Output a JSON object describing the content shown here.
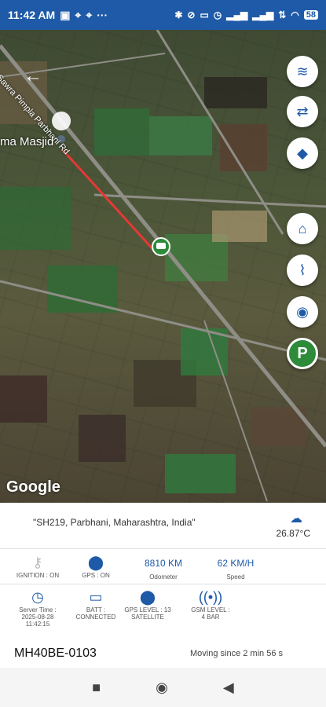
{
  "status_bar": {
    "time": "11:42 AM",
    "left_icons": [
      "message-icon",
      "location-icon",
      "location-icon",
      "more-icon"
    ],
    "right_icons": [
      "bluetooth-icon",
      "mute-icon",
      "battery-saver-icon",
      "alarm-icon",
      "signal-icon",
      "signal-icon",
      "data-icon",
      "wifi-icon"
    ],
    "battery": "58"
  },
  "map": {
    "road_label": "Sawra Pimpla Parbhani Rd",
    "place_label": "ma Masjid",
    "attribution": "Google",
    "route_color": "#e53935",
    "vehicle_marker_color": "#2e8b3a",
    "fabs": [
      "layers-icon",
      "swap-icon",
      "directions-icon",
      "geofence-icon",
      "attachment-icon",
      "my-location-icon",
      "parking-icon"
    ]
  },
  "info": {
    "address": "\"SH219, Parbhani, Maharashtra, India\"",
    "temperature": "26.87°C",
    "weather_icon": "partly-cloudy-icon",
    "stats_row1": [
      {
        "icon": "key-icon",
        "value": "",
        "label": "IGNITION : ON"
      },
      {
        "icon": "location-pin-icon",
        "value": "",
        "label": "GPS : ON"
      },
      {
        "icon": "",
        "value": "8810 KM",
        "label": "Odometer"
      },
      {
        "icon": "",
        "value": "62 KM/H",
        "label": "Speed"
      }
    ],
    "server_time_label": "Server Time :",
    "server_time_value": "2025-08-28 11:42:15",
    "batt_label": "BATT : CONNECTED",
    "gps_level_label": "GPS LEVEL : 13 SATELLITE",
    "gsm_level_label": "GSM LEVEL : 4 BAR",
    "vehicle_number": "MH40BE-0103",
    "moving_since": "Moving since 2 min 56 s"
  },
  "nav_bar": {
    "buttons": [
      "recent-apps-icon",
      "home-icon",
      "back-icon"
    ]
  }
}
